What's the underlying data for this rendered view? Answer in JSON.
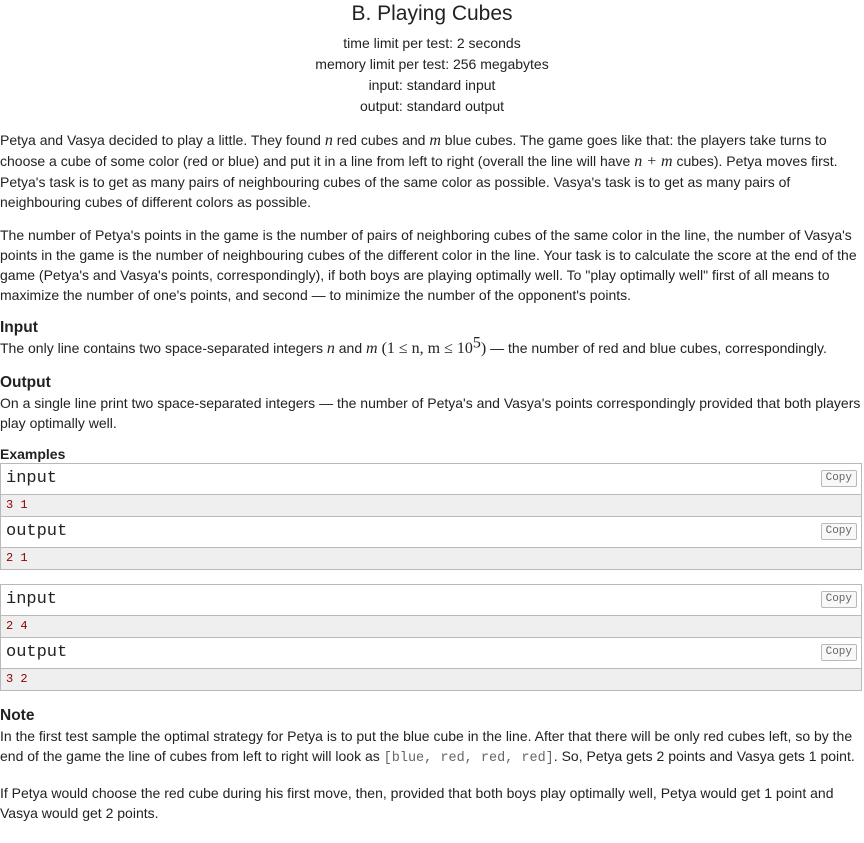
{
  "problem": {
    "title": "B. Playing Cubes",
    "time_limit": "time limit per test: 2 seconds",
    "memory_limit": "memory limit per test: 256 megabytes",
    "input_spec": "input: standard input",
    "output_spec": "output: standard output"
  },
  "statement": {
    "p1_a": "Petya and Vasya decided to play a little. They found ",
    "p1_n": "n",
    "p1_b": " red cubes and ",
    "p1_m": "m",
    "p1_c": " blue cubes. The game goes like that: the players take turns to choose a cube of some color (red or blue) and put it in a line from left to right (overall the line will have ",
    "p1_nm": "n + m",
    "p1_d": " cubes). Petya moves first. Petya's task is to get as many pairs of neighbouring cubes of the same color as possible. Vasya's task is to get as many pairs of neighbouring cubes of different colors as possible.",
    "p2": "The number of Petya's points in the game is the number of pairs of neighboring cubes of the same color in the line, the number of Vasya's points in the game is the number of neighbouring cubes of the different color in the line. Your task is to calculate the score at the end of the game (Petya's and Vasya's points, correspondingly), if both boys are playing optimally well. To \"play optimally well\" first of all means to maximize the number of one's points, and second — to minimize the number of the opponent's points."
  },
  "input_section": {
    "title": "Input",
    "text_a": "The only line contains two space-separated integers ",
    "n": "n",
    "and": " and ",
    "m": "m",
    "constraint": " (1 ≤ n, m ≤ 10",
    "exp": "5",
    "close": ")",
    "text_b": " — the number of red and blue cubes, correspondingly."
  },
  "output_section": {
    "title": "Output",
    "text": "On a single line print two space-separated integers — the number of Petya's and Vasya's points correspondingly provided that both players play optimally well."
  },
  "examples": {
    "title": "Examples",
    "copy_label": "Copy",
    "input_label": "input",
    "output_label": "output",
    "tests": [
      {
        "input": "3 1",
        "output": "2 1"
      },
      {
        "input": "2 4",
        "output": "3 2"
      }
    ]
  },
  "note": {
    "title": "Note",
    "p1_a": "In the first test sample the optimal strategy for Petya is to put the blue cube in the line. After that there will be only red cubes left, so by the end of the game the line of cubes from left to right will look as ",
    "p1_code": "[blue, red, red, red]",
    "p1_b": ". So, Petya gets 2 points and Vasya gets 1 point.",
    "p2": "If Petya would choose the red cube during his first move, then, provided that both boys play optimally well, Petya would get 1 point and Vasya would get 2 points."
  }
}
